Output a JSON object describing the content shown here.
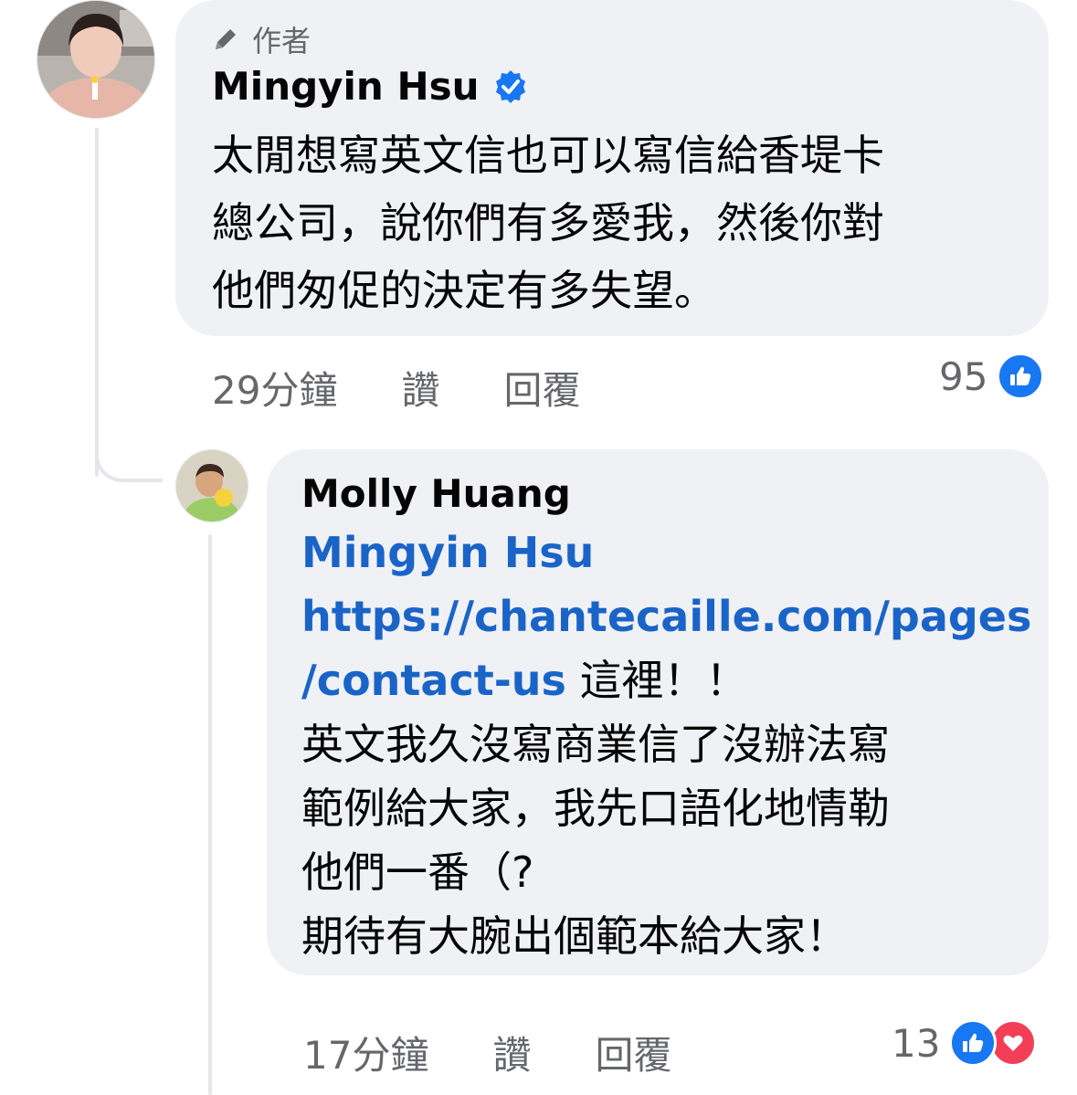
{
  "colors": {
    "bubble": "#eff1f4",
    "link": "#1a64c7",
    "meta": "#65676b",
    "like": "#1877f2",
    "love": "#f33e58",
    "verified": "#1877f2"
  },
  "comment": {
    "author_tag": "作者",
    "author_tag_icon": "pencil-icon",
    "name": "Mingyin Hsu",
    "verified_icon": "verified-badge-icon",
    "lines": [
      "太閒想寫英文信也可以寫信給香堤卡",
      "總公司，說你們有多愛我，然後你對",
      "他們匆促的決定有多失望。"
    ],
    "time": "29分鐘",
    "like_label": "讚",
    "reply_label": "回覆",
    "reaction_count": "95",
    "reaction_icons": [
      "like-icon"
    ]
  },
  "reply": {
    "name": "Molly Huang",
    "mention": "Mingyin Hsu",
    "link_line1": "https://chantecaille.com/pages",
    "link_line2": "/contact-us",
    "after_link": " 這裡！！",
    "lines": [
      "英文我久沒寫商業信了沒辦法寫",
      "範例給大家，我先口語化地情勒",
      "他們一番（?",
      "期待有大腕出個範本給大家！"
    ],
    "time": "17分鐘",
    "like_label": "讚",
    "reply_label": "回覆",
    "reaction_count": "13",
    "reaction_icons": [
      "like-icon",
      "love-icon"
    ]
  }
}
